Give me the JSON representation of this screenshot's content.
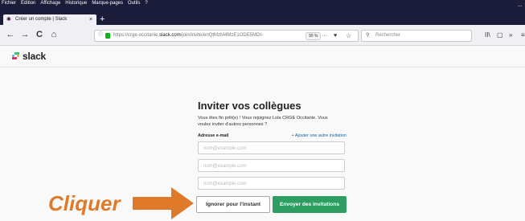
{
  "menubar": [
    "Fichier",
    "Édition",
    "Affichage",
    "Historique",
    "Marque-pages",
    "Outils",
    "?"
  ],
  "tab": {
    "title": "Créer un compte | Slack",
    "close": "×"
  },
  "newtab": "+",
  "window_controls": [
    "—",
    "□"
  ],
  "nav": {
    "back": "←",
    "forward": "→",
    "reload": "C",
    "home": "⌂"
  },
  "urlbar": {
    "prefix": "https://crge-occitanie.",
    "domain": "slack.com",
    "path": "/join/invite/enQtMzM4MzE1ODE5MDI-",
    "zoom": "90 %",
    "more": "···"
  },
  "search": {
    "placeholder": "Rechercher"
  },
  "toolbar_right": {
    "library": "II\\",
    "sidebar": "▢",
    "overflow": "»",
    "menu": "≡"
  },
  "logo": {
    "text": "slack",
    "colors": [
      "#36c5f0",
      "#2eb67d",
      "#ecb22e",
      "#e01e5a"
    ]
  },
  "page": {
    "title": "Inviter vos collègues",
    "description": "Vous êtes fin prêt(e) ! Vous rejoignez Lola CRGE Occitanie. Vous voulez inviter d'autres personnes ?",
    "email_label": "Adresse e-mail",
    "add_link": "+ Ajouter une autre invitation",
    "email_placeholder": "nom@example.com",
    "skip_button": "Ignorer pour l'instant",
    "send_button": "Envoyer des invitations"
  },
  "annotation": {
    "text": "Cliquer",
    "color": "#e07a2b"
  }
}
